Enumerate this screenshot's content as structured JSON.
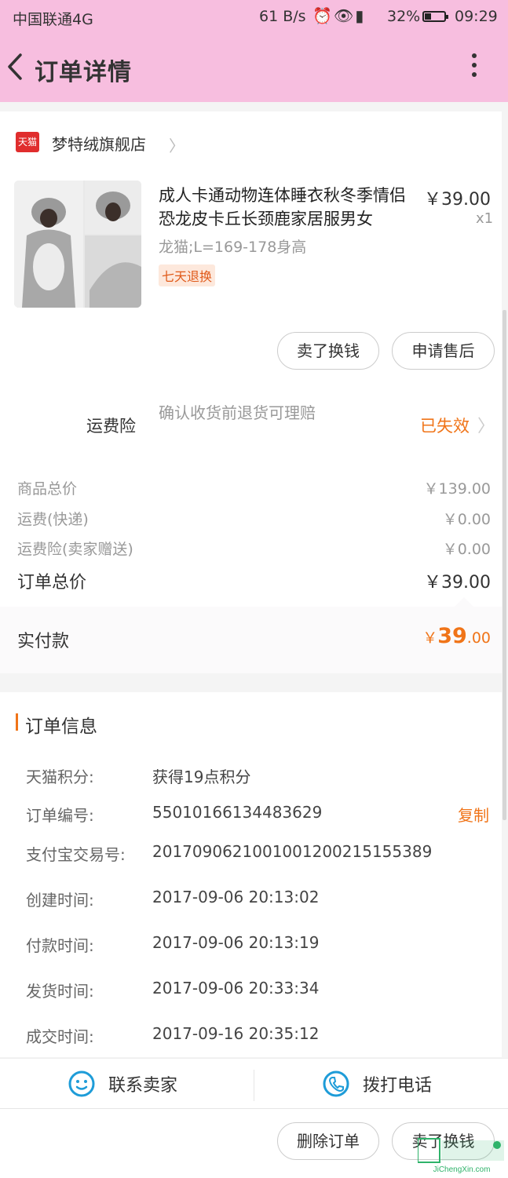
{
  "status_bar": {
    "carrier": "中国联通4G",
    "speed": "61 B/s",
    "battery": "32%",
    "battery_level": 0.32,
    "time": "09:29"
  },
  "nav": {
    "title": "订单详情",
    "back_icon": "chevron-left-icon",
    "more_icon": "more-vertical-icon"
  },
  "shop": {
    "badge": "天猫",
    "name": "梦特绒旗舰店"
  },
  "product": {
    "title": "成人卡通动物连体睡衣秋冬季情侣恐龙皮卡丘长颈鹿家居服男女",
    "price": "￥39.00",
    "qty": "x1",
    "spec": "龙猫;L=169-178身高",
    "tag": "七天退换"
  },
  "product_actions": {
    "sell": "卖了换钱",
    "after_sale": "申请售后"
  },
  "insurance": {
    "label": "运费险",
    "desc": "确认收货前退货可理赔",
    "status": "已失效"
  },
  "fees": [
    {
      "label": "商品总价",
      "value": "￥139.00"
    },
    {
      "label": "运费(快递)",
      "value": "￥0.00"
    },
    {
      "label": "运费险(卖家赠送)",
      "value": "￥0.00"
    }
  ],
  "order_total": {
    "label": "订单总价",
    "value": "￥39.00"
  },
  "paid": {
    "label": "实付款",
    "currency": "￥",
    "integer": "39",
    "decimal": ".00"
  },
  "order_info": {
    "title": "订单信息",
    "rows": [
      {
        "key": "天猫积分:",
        "value": "获得19点积分"
      },
      {
        "key": "订单编号:",
        "value": "55010166134483629"
      },
      {
        "key": "支付宝交易号:",
        "value": "2017090621001001200215155389"
      },
      {
        "key": "创建时间:",
        "value": "2017-09-06 20:13:02"
      },
      {
        "key": "付款时间:",
        "value": "2017-09-06 20:13:19"
      },
      {
        "key": "发货时间:",
        "value": "2017-09-06 20:33:34"
      },
      {
        "key": "成交时间:",
        "value": "2017-09-16 20:35:12"
      }
    ],
    "copy": "复制"
  },
  "contact": {
    "seller": "联系卖家",
    "call": "拨打电话"
  },
  "bottom_actions": {
    "delete": "删除订单",
    "sell": "卖了换钱"
  },
  "watermark": {
    "text": "JiChengXin.com"
  },
  "colors": {
    "header_pink": "#f7bedf",
    "accent_orange": "#f07418",
    "tmall_red": "#e02d2d",
    "icon_blue": "#1e9cd8"
  }
}
